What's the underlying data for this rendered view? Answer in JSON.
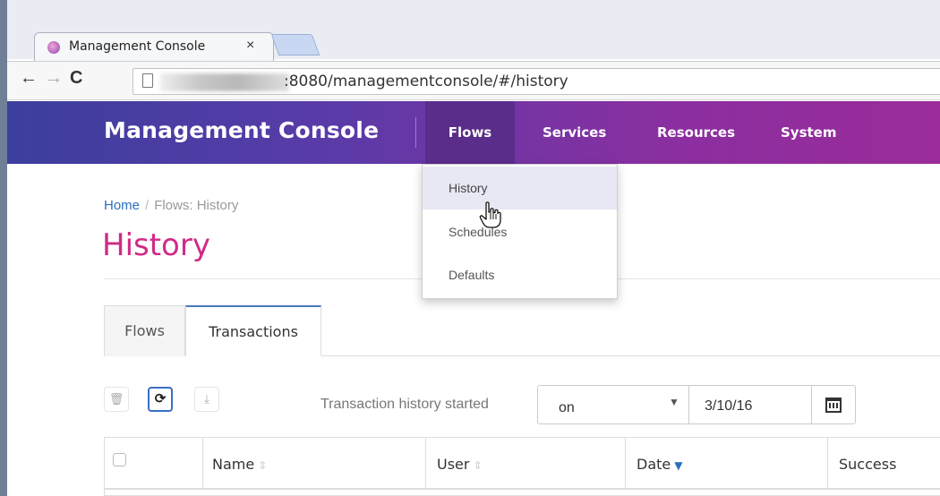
{
  "browser": {
    "tab_title": "Management Console",
    "tab_close": "×",
    "url": ":8080/managementconsole/#/history",
    "back": "←",
    "forward": "→",
    "reload": "C"
  },
  "app": {
    "brand": "Management Console",
    "nav": [
      "Flows",
      "Services",
      "Resources",
      "System"
    ],
    "active_nav": "Flows",
    "colors": {
      "nav_start": "#3c3f9e",
      "nav_end": "#9b2b9a",
      "title": "#d12a86",
      "link": "#2a6fbf"
    }
  },
  "dropdown": {
    "items": [
      "History",
      "Schedules",
      "Defaults"
    ],
    "highlighted": "History"
  },
  "breadcrumb": {
    "home": "Home",
    "separator": "/",
    "current": "Flows: History"
  },
  "page_title": "History",
  "tabs": {
    "flows": "Flows",
    "transactions": "Transactions",
    "active": "Transactions"
  },
  "toolbar": {
    "delete_icon": "trash-icon",
    "refresh_icon": "refresh-icon",
    "download_icon": "download-icon"
  },
  "filter": {
    "label": "Transaction history started",
    "mode": "on",
    "date": "3/10/16",
    "caret": "▼"
  },
  "table": {
    "columns": [
      "Name",
      "User",
      "Date",
      "Success"
    ],
    "sort_column": "Date",
    "sort_direction": "descending"
  }
}
